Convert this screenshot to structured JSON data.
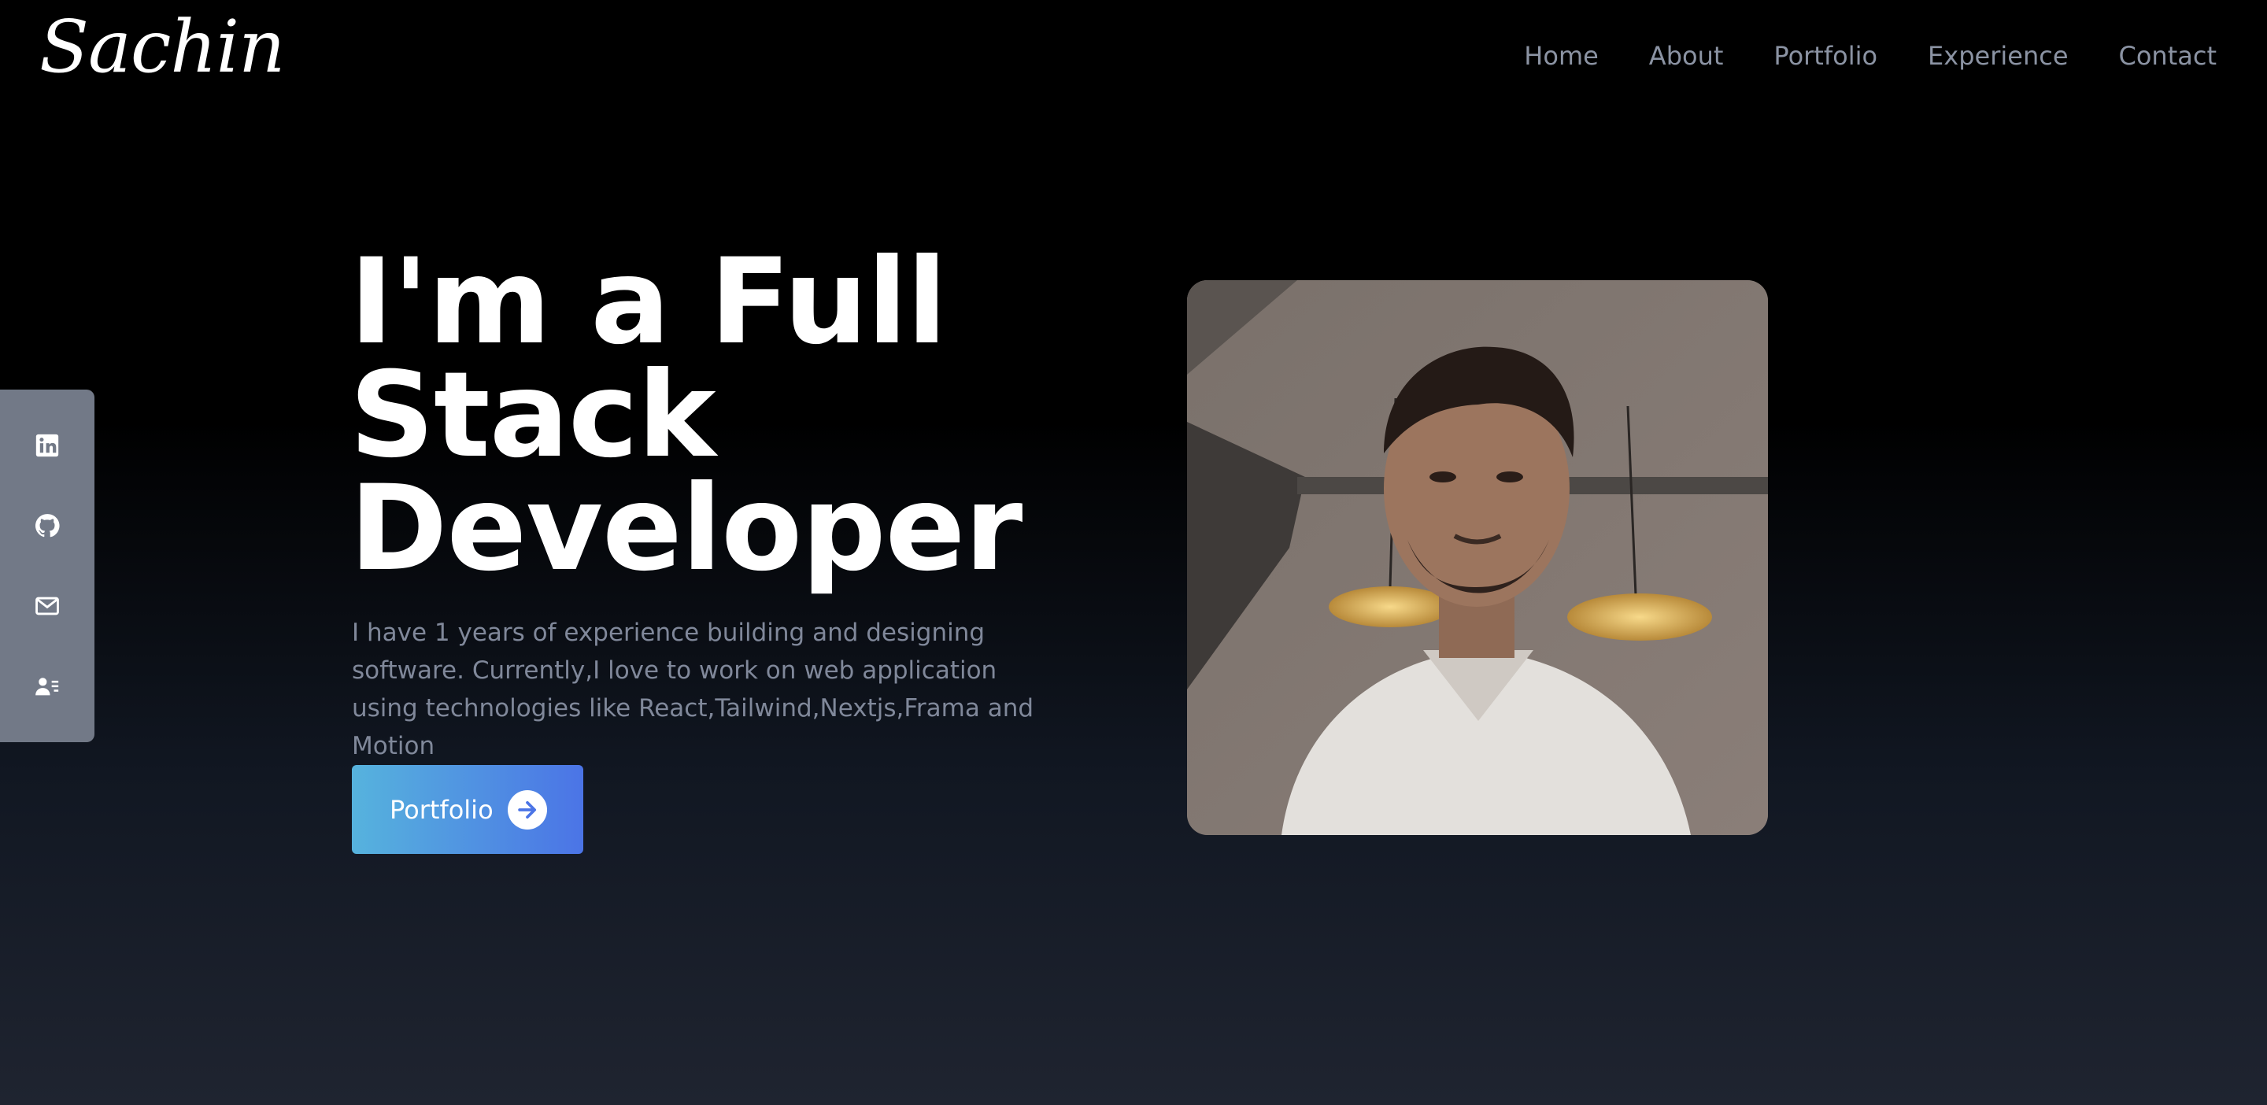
{
  "header": {
    "logo": "Sachin",
    "nav": [
      "Home",
      "About",
      "Portfolio",
      "Experience",
      "Contact"
    ]
  },
  "social": {
    "icons": [
      "linkedin-icon",
      "github-icon",
      "mail-icon",
      "contact-card-icon"
    ]
  },
  "hero": {
    "headline_lines": [
      "I'm a Full",
      "Stack",
      "Developer"
    ],
    "description": "I have 1 years of experience building and designing software. Currently,I love to work on web application using technologies like React,Tailwind,Nextjs,Frama and Motion",
    "cta_label": "Portfolio"
  },
  "colors": {
    "sidebar": "#727987",
    "nav_text": "#8b93a3",
    "button_start": "#56b3dd",
    "button_end": "#4b74e6"
  }
}
